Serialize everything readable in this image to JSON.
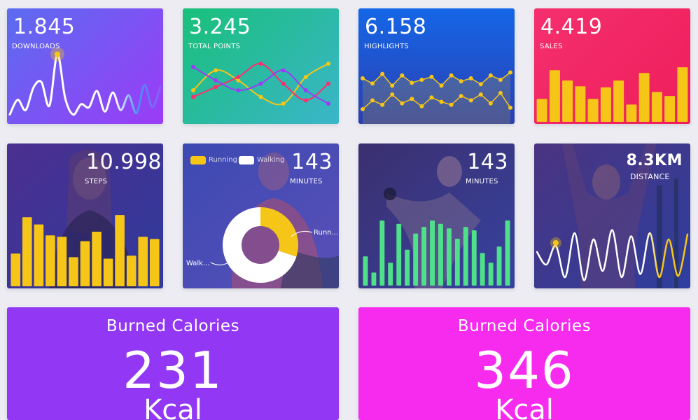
{
  "colors": {
    "background": "#ececf2",
    "accent_yellow": "#f5c518",
    "accent_green": "#4fe08a",
    "accent_white": "#ffffff"
  },
  "cards": {
    "downloads": {
      "value": "1.845",
      "label": "DOWNLOADS",
      "gradient": [
        "#5b6cf0",
        "#9b3cf7"
      ]
    },
    "total_points": {
      "value": "3.245",
      "label": "TOTAL POINTS",
      "gradient": [
        "#19c07a",
        "#3bb5c9"
      ]
    },
    "highlights": {
      "value": "6.158",
      "label": "HIGHLIGHTS",
      "gradient": [
        "#1566e8",
        "#2a47b8"
      ]
    },
    "sales": {
      "value": "4.419",
      "label": "SALES",
      "gradient": [
        "#f52f6e",
        "#ee1e5a"
      ]
    },
    "steps": {
      "value": "10.998",
      "label": "STEPS"
    },
    "minutes_1": {
      "value": "143",
      "label": "MINUTES",
      "legend": [
        "Running",
        "Walking"
      ],
      "donut_labels": {
        "running": "Runn...",
        "walking": "Walk..."
      }
    },
    "minutes_2": {
      "value": "143",
      "label": "MINUTES"
    },
    "distance": {
      "value": "8.3KM",
      "label": "DISTANCE"
    },
    "calories_1": {
      "title": "Burned Calories",
      "value": "231",
      "unit": "Kcal",
      "color": "#9238f5"
    },
    "calories_2": {
      "title": "Burned Calories",
      "value": "346",
      "unit": "Kcal",
      "color": "#f62bee"
    }
  },
  "chart_data": [
    {
      "type": "line",
      "series": [
        {
          "values": [
            8,
            28,
            14,
            45,
            52,
            20,
            90,
            30,
            8,
            22,
            18,
            40,
            12,
            38,
            14,
            34,
            10,
            48,
            18,
            46
          ]
        }
      ],
      "ylim": [
        0,
        100
      ]
    },
    {
      "type": "line",
      "series": [
        {
          "values": [
            40,
            70,
            55,
            30,
            20,
            60,
            80
          ]
        },
        {
          "values": [
            30,
            45,
            60,
            80,
            50,
            25,
            50
          ]
        },
        {
          "values": [
            75,
            55,
            40,
            50,
            70,
            40,
            20
          ]
        }
      ],
      "ylim": [
        0,
        100
      ]
    },
    {
      "type": "line",
      "series": [
        {
          "values": [
            62,
            55,
            68,
            52,
            66,
            56,
            60,
            64,
            52,
            66,
            58,
            62,
            54,
            66,
            60,
            70
          ]
        },
        {
          "values": [
            20,
            32,
            26,
            40,
            28,
            34,
            24,
            36,
            30,
            26,
            38,
            32,
            40,
            28,
            42,
            22
          ]
        }
      ],
      "ylim": [
        0,
        100
      ]
    },
    {
      "type": "bar",
      "values": [
        40,
        90,
        72,
        62,
        40,
        60,
        72,
        30,
        85,
        52,
        45,
        95
      ],
      "ylim": [
        0,
        100
      ]
    },
    {
      "type": "bar",
      "values": [
        45,
        95,
        85,
        70,
        68,
        40,
        62,
        75,
        38,
        98,
        42,
        68,
        65
      ],
      "ylim": [
        0,
        100
      ]
    },
    {
      "type": "pie",
      "values": [
        30,
        70
      ],
      "categories": [
        "Running",
        "Walking"
      ]
    },
    {
      "type": "bar",
      "values": [
        45,
        20,
        100,
        35,
        95,
        55,
        80,
        90,
        100,
        95,
        88,
        72,
        90,
        85,
        50,
        35,
        60,
        100
      ],
      "ylim": [
        0,
        100
      ]
    },
    {
      "type": "line",
      "series": [
        {
          "values": [
            50,
            30,
            60,
            10,
            80,
            5,
            70,
            20,
            85,
            10,
            75,
            15,
            80,
            10,
            70,
            12,
            78
          ]
        }
      ],
      "ylim": [
        0,
        100
      ]
    }
  ]
}
